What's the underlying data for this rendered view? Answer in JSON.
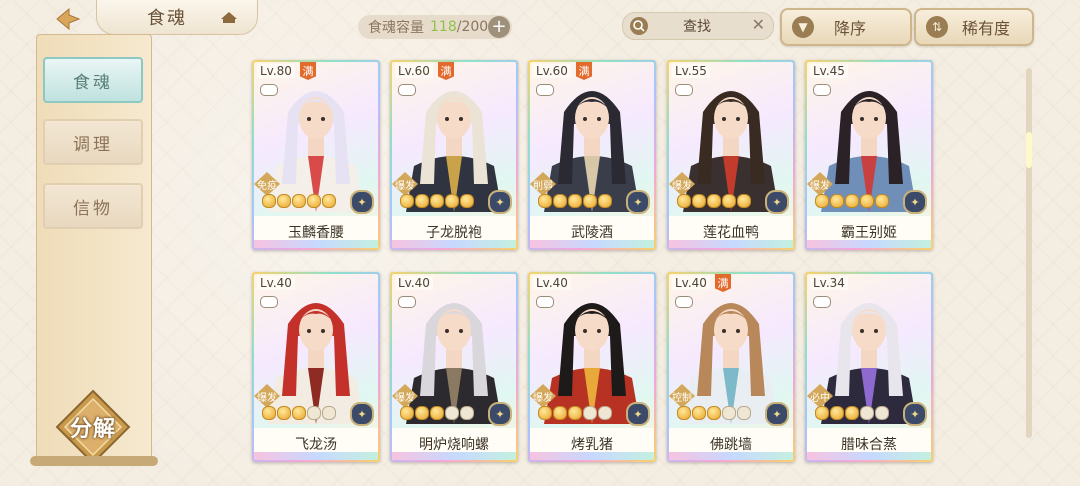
{
  "header": {
    "title": "食魂",
    "capacity_label": "食魂容量",
    "capacity_current": "118",
    "capacity_total": "/200",
    "search_placeholder": "查找",
    "sort_label": "降序",
    "rarity_label": "稀有度"
  },
  "sidebar": {
    "items": [
      {
        "label": "食魂",
        "active": true
      },
      {
        "label": "调理",
        "active": false
      },
      {
        "label": "信物",
        "active": false
      }
    ],
    "decompose_label": "分解"
  },
  "cards": [
    {
      "level": "Lv.80",
      "full": "满",
      "role": "免疫",
      "stars": 5,
      "name": "玉麟香腰",
      "hair": "#e6e2f4",
      "robe": "#f4efe8",
      "accent": "#d94b4b"
    },
    {
      "level": "Lv.60",
      "full": "满",
      "role": "爆发",
      "stars": 5,
      "name": "子龙脱袍",
      "hair": "#ebe4d6",
      "robe": "#2f3440",
      "accent": "#c9a24a"
    },
    {
      "level": "Lv.60",
      "full": "满",
      "role": "削弱",
      "stars": 5,
      "name": "武陵酒",
      "hair": "#2b2a33",
      "robe": "#3a3e4a",
      "accent": "#d7c7a6"
    },
    {
      "level": "Lv.55",
      "full": "",
      "role": "爆发",
      "stars": 5,
      "name": "莲花血鸭",
      "hair": "#3a2b22",
      "robe": "#3b3030",
      "accent": "#c23b2c"
    },
    {
      "level": "Lv.45",
      "full": "",
      "role": "爆发",
      "stars": 5,
      "name": "霸王别姬",
      "hair": "#2a2226",
      "robe": "#6f8fb8",
      "accent": "#c94040"
    },
    {
      "level": "Lv.40",
      "full": "",
      "role": "爆发",
      "stars": 3,
      "name": "飞龙汤",
      "hair": "#c4302a",
      "robe": "#f2ece3",
      "accent": "#8e2b22"
    },
    {
      "level": "Lv.40",
      "full": "",
      "role": "爆发",
      "stars": 3,
      "name": "明炉烧响螺",
      "hair": "#d9d6dc",
      "robe": "#2c2a2f",
      "accent": "#8a7a62"
    },
    {
      "level": "Lv.40",
      "full": "",
      "role": "爆发",
      "stars": 3,
      "name": "烤乳猪",
      "hair": "#1e1a1a",
      "robe": "#b83224",
      "accent": "#e9a83a"
    },
    {
      "level": "Lv.40",
      "full": "满",
      "role": "控制",
      "stars": 3,
      "name": "佛跳墙",
      "hair": "#b9885a",
      "robe": "#e9eef3",
      "accent": "#7db9c8"
    },
    {
      "level": "Lv.34",
      "full": "",
      "role": "必中",
      "stars": 3,
      "name": "腊味合蒸",
      "hair": "#e8e6ec",
      "robe": "#2e2a3e",
      "accent": "#8e6ad0"
    }
  ]
}
